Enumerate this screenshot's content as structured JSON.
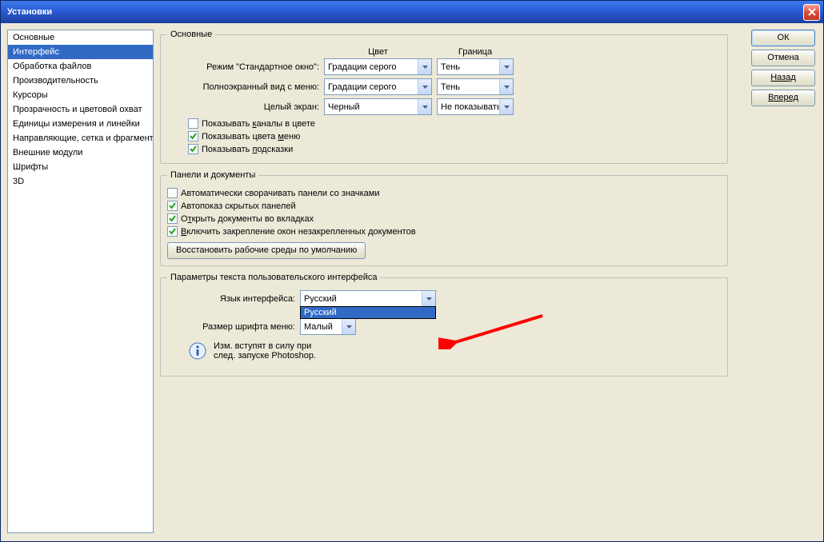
{
  "window": {
    "title": "Установки"
  },
  "sidebar": {
    "items": [
      "Основные",
      "Интерфейс",
      "Обработка файлов",
      "Производительность",
      "Курсоры",
      "Прозрачность и цветовой охват",
      "Единицы измерения и линейки",
      "Направляющие, сетка и фрагменты",
      "Внешние модули",
      "Шрифты",
      "3D"
    ]
  },
  "buttons": {
    "ok": "ОК",
    "cancel": "Отмена",
    "back": "Назад",
    "forward": "Вперед"
  },
  "group1": {
    "legend": "Основные",
    "col_color": "Цвет",
    "col_border": "Граница",
    "row1_label": "Режим \"Стандартное окно\":",
    "row1_color": "Градации серого",
    "row1_border": "Тень",
    "row2_label": "Полноэкранный вид с меню:",
    "row2_color": "Градации серого",
    "row2_border": "Тень",
    "row3_label": "Целый экран:",
    "row3_color": "Черный",
    "row3_border": "Не показывать",
    "chk1_a": "Показывать ",
    "chk1_b": "к",
    "chk1_c": "аналы в цвете",
    "chk2_a": "Показывать цвета ",
    "chk2_b": "м",
    "chk2_c": "еню",
    "chk3_a": "Показывать ",
    "chk3_b": "п",
    "chk3_c": "одсказки"
  },
  "group2": {
    "legend": "Панели и документы",
    "chk1": "Автоматически сворачивать панели со значками",
    "chk2": "Автопоказ скрытых панелей",
    "chk3_a": "О",
    "chk3_b": "т",
    "chk3_c": "крыть документы во вкладках",
    "chk4_a": "В",
    "chk4_b": "ключить закрепление окон незакрепленных документов",
    "restore_btn": "Восстановить рабочие среды по умолчанию"
  },
  "group3": {
    "legend": "Параметры текста пользовательского интерфейса",
    "lang_label": "Язык интерфейса:",
    "lang_value": "Русский",
    "lang_option": "Русский",
    "font_label": "Размер шрифта меню:",
    "font_value": "Малый",
    "info1": "Изм. вступят в силу при",
    "info2": "след. запуске Photoshop."
  }
}
